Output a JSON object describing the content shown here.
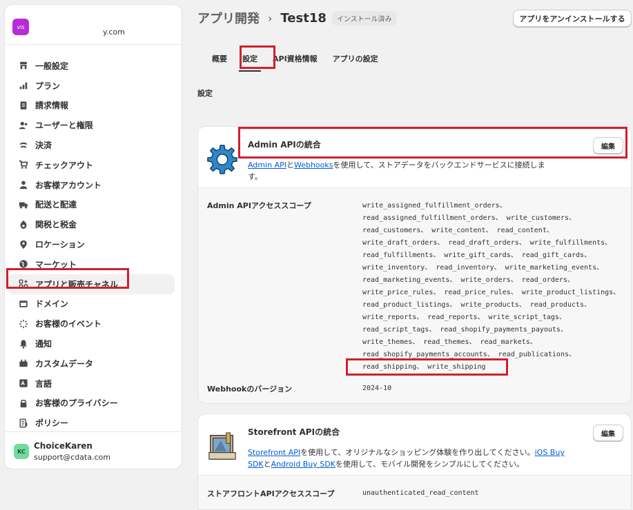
{
  "store": {
    "avatar_text": "vis",
    "domain": "y.com"
  },
  "sidebar": {
    "items": [
      {
        "label": "一般設定",
        "icon": "store-icon"
      },
      {
        "label": "プラン",
        "icon": "chart-icon"
      },
      {
        "label": "請求情報",
        "icon": "receipt-icon"
      },
      {
        "label": "ユーザーと権限",
        "icon": "users-icon"
      },
      {
        "label": "決済",
        "icon": "payment-icon"
      },
      {
        "label": "チェックアウト",
        "icon": "cart-icon"
      },
      {
        "label": "お客様アカウント",
        "icon": "person-icon"
      },
      {
        "label": "配送と配達",
        "icon": "truck-icon"
      },
      {
        "label": "関税と税金",
        "icon": "tax-icon"
      },
      {
        "label": "ロケーション",
        "icon": "location-icon"
      },
      {
        "label": "マーケット",
        "icon": "globe-icon"
      },
      {
        "label": "アプリと販売チャネル",
        "icon": "apps-icon"
      },
      {
        "label": "ドメイン",
        "icon": "domain-icon"
      },
      {
        "label": "お客様のイベント",
        "icon": "events-icon"
      },
      {
        "label": "通知",
        "icon": "bell-icon"
      },
      {
        "label": "カスタムデータ",
        "icon": "custom-data-icon"
      },
      {
        "label": "言語",
        "icon": "language-icon"
      },
      {
        "label": "お客様のプライバシー",
        "icon": "lock-icon"
      },
      {
        "label": "ポリシー",
        "icon": "policy-icon"
      }
    ]
  },
  "user": {
    "initials": "KC",
    "name": "ChoiceKaren",
    "email": "support@cdata.com"
  },
  "header": {
    "parent": "アプリ開発",
    "separator": "›",
    "current": "Test18",
    "badge": "インストール済み",
    "uninstall_label": "アプリをアンインストールする"
  },
  "tabs": [
    {
      "label": "概要"
    },
    {
      "label": "設定"
    },
    {
      "label": "API資格情報"
    },
    {
      "label": "アプリの設定"
    }
  ],
  "section_label": "設定",
  "admin_card": {
    "title": "Admin APIの統合",
    "edit_label": "編集",
    "desc_link1": "Admin API",
    "desc_text1": "と",
    "desc_link2": "Webhooks",
    "desc_text2": "を使用して、ストアデータをバックエンドサービスに接続しま",
    "desc_text3": "す。",
    "scopes_label": "Admin APIアクセススコープ",
    "scope_lines": [
      "write_assigned_fulfillment_orders、",
      "read_assigned_fulfillment_orders、 write_customers、",
      "read_customers、 write_content、 read_content、",
      "write_draft_orders、 read_draft_orders、 write_fulfillments、",
      "read_fulfillments、 write_gift_cards、 read_gift_cards、",
      "write_inventory、 read_inventory、 write_marketing_events、",
      "read_marketing_events、 write_orders、 read_orders、",
      "write_price_rules、 read_price_rules、 write_product_listings、",
      "read_product_listings、 write_products、 read_products、",
      "write_reports、 read_reports、 write_script_tags、",
      "read_script_tags、 read_shopify_payments_payouts、",
      "write_themes、 read_themes、 read_markets、",
      "read_shopify_payments_accounts、 read_publications、",
      "read_shipping、 write_shipping"
    ],
    "webhook_label": "Webhookのバージョン",
    "webhook_value": "2024-10"
  },
  "storefront_card": {
    "title": "Storefront APIの統合",
    "edit_label": "編集",
    "desc_link1": "Storefront API",
    "desc_text1": "を使用して、オリジナルなショッピング体験を作り出してください。",
    "desc_link2": "iOS Buy SDK",
    "desc_text2": "と",
    "desc_link3": "Android Buy SDK",
    "desc_text3": "を使用して、モバイル開発をシンプルにしてください。",
    "scopes_label": "ストアフロントAPIアクセススコープ",
    "scopes_value": "unauthenticated_read_content"
  },
  "colors": {
    "highlight": "#d11f2a",
    "link": "#005bd3",
    "store_avatar": "#b82bd6",
    "user_avatar": "#6fdc9c"
  }
}
